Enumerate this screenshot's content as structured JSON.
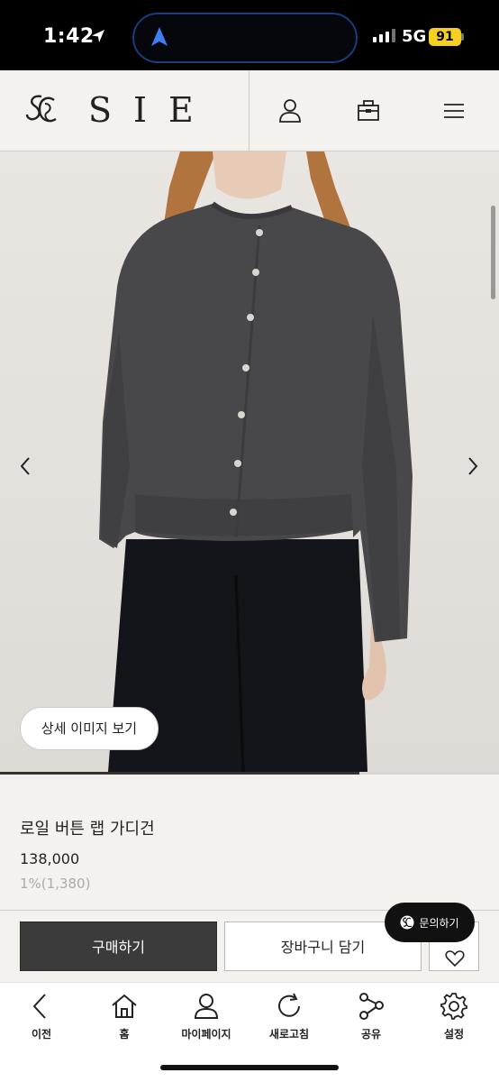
{
  "status_bar": {
    "time": "1:42",
    "network": "5G",
    "battery": "91"
  },
  "header": {
    "brand": "SIE",
    "icons": [
      "user-icon",
      "bag-icon",
      "menu-icon"
    ]
  },
  "gallery": {
    "detail_button": "상세 이미지 보기",
    "progress_fraction": 0.72
  },
  "product": {
    "name": "로일 버튼 랩 가디건",
    "price": "138,000",
    "point": "1%(1,380)"
  },
  "actions": {
    "buy": "구매하기",
    "cart": "장바구니 담기",
    "inquiry": "문의하기"
  },
  "toolbar": {
    "items": [
      {
        "label": "이전",
        "icon": "back-icon"
      },
      {
        "label": "홈",
        "icon": "home-icon"
      },
      {
        "label": "마이페이지",
        "icon": "user-icon"
      },
      {
        "label": "새로고침",
        "icon": "refresh-icon"
      },
      {
        "label": "공유",
        "icon": "share-icon"
      },
      {
        "label": "설정",
        "icon": "gear-icon"
      }
    ]
  },
  "colors": {
    "background": "#f4f2ef",
    "buy_button": "#3b3b3b",
    "battery": "#f5d020",
    "island_border": "#1a3c7a"
  }
}
